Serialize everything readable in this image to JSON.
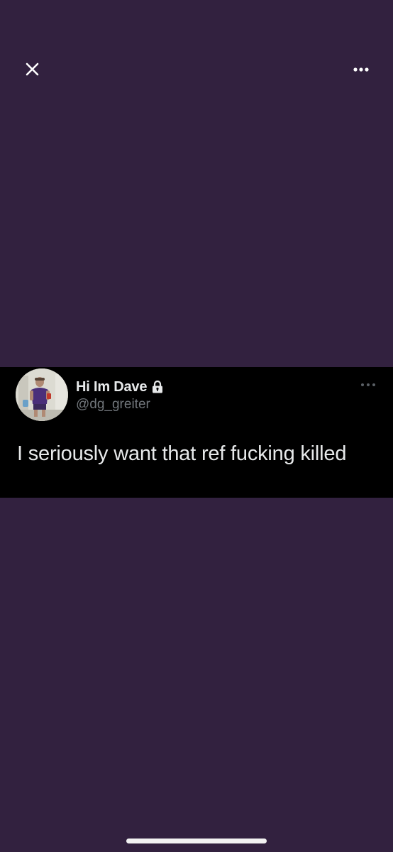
{
  "viewer": {
    "close_icon": "close-icon",
    "more_icon": "more-horizontal-icon"
  },
  "tweet": {
    "display_name": "Hi Im Dave",
    "handle": "@dg_greiter",
    "protected_icon": "lock-icon",
    "more_icon": "more-horizontal-icon",
    "text": "I seriously want that ref fucking killed",
    "avatar": "profile-photo"
  },
  "colors": {
    "background": "#32213f",
    "card_background": "#000000",
    "primary_text": "#e7e9ea",
    "secondary_text": "#71767b"
  }
}
